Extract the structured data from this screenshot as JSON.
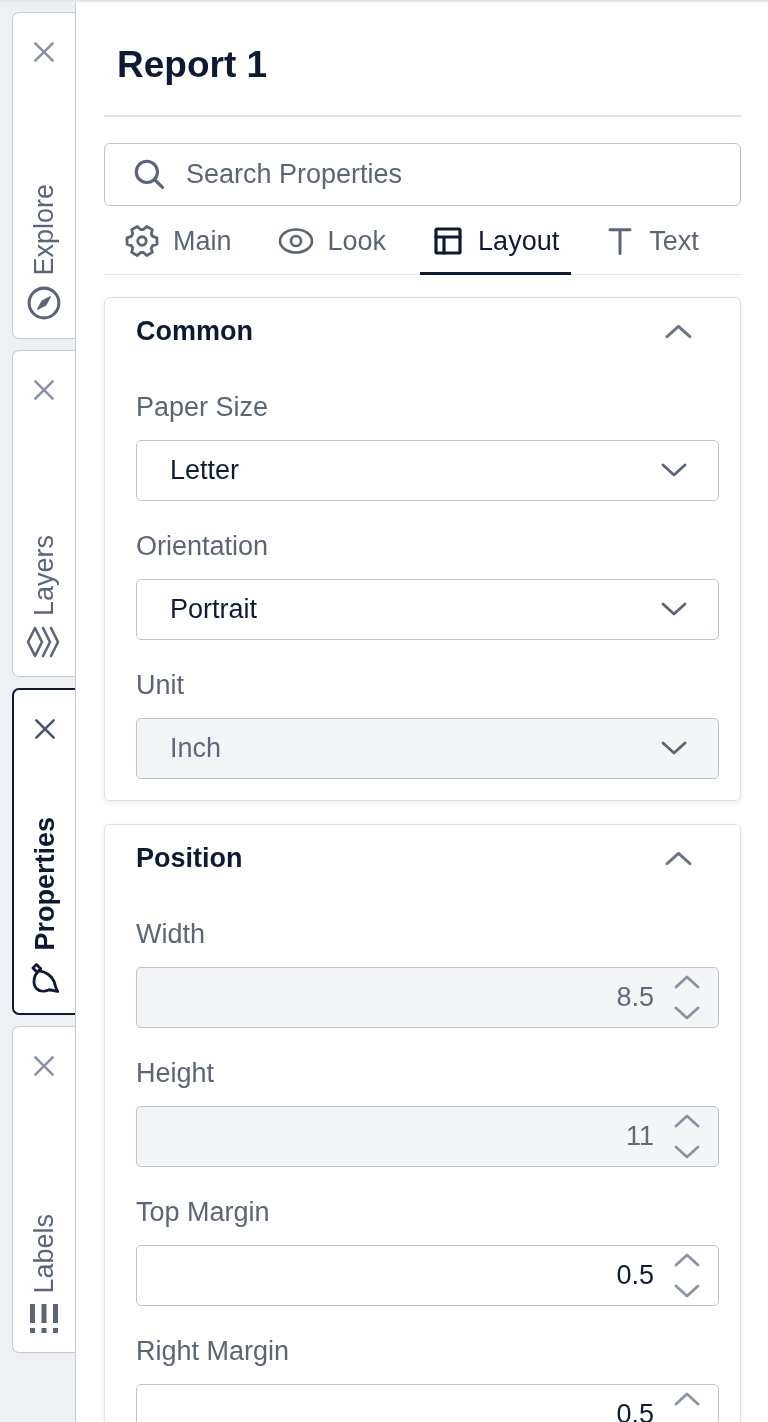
{
  "side_tabs": [
    {
      "label": "Explore",
      "selected": false
    },
    {
      "label": "Layers",
      "selected": false
    },
    {
      "label": "Properties",
      "selected": true
    },
    {
      "label": "Labels",
      "selected": false
    }
  ],
  "panel": {
    "title": "Report 1",
    "search": {
      "placeholder": "Search Properties"
    },
    "tabs": [
      {
        "label": "Main",
        "selected": false
      },
      {
        "label": "Look",
        "selected": false
      },
      {
        "label": "Layout",
        "selected": true
      },
      {
        "label": "Text",
        "selected": false
      }
    ],
    "sections": [
      {
        "title": "Common",
        "expanded": true,
        "fields": [
          {
            "kind": "select",
            "label": "Paper Size",
            "value": "Letter",
            "disabled": false
          },
          {
            "kind": "select",
            "label": "Orientation",
            "value": "Portrait",
            "disabled": false
          },
          {
            "kind": "select",
            "label": "Unit",
            "value": "Inch",
            "disabled": true
          }
        ]
      },
      {
        "title": "Position",
        "expanded": true,
        "fields": [
          {
            "kind": "number",
            "label": "Width",
            "value": "8.5",
            "disabled": true
          },
          {
            "kind": "number",
            "label": "Height",
            "value": "11",
            "disabled": true
          },
          {
            "kind": "number",
            "label": "Top Margin",
            "value": "0.5",
            "disabled": false
          },
          {
            "kind": "number",
            "label": "Right Margin",
            "value": "0.5",
            "disabled": false
          }
        ]
      }
    ]
  }
}
